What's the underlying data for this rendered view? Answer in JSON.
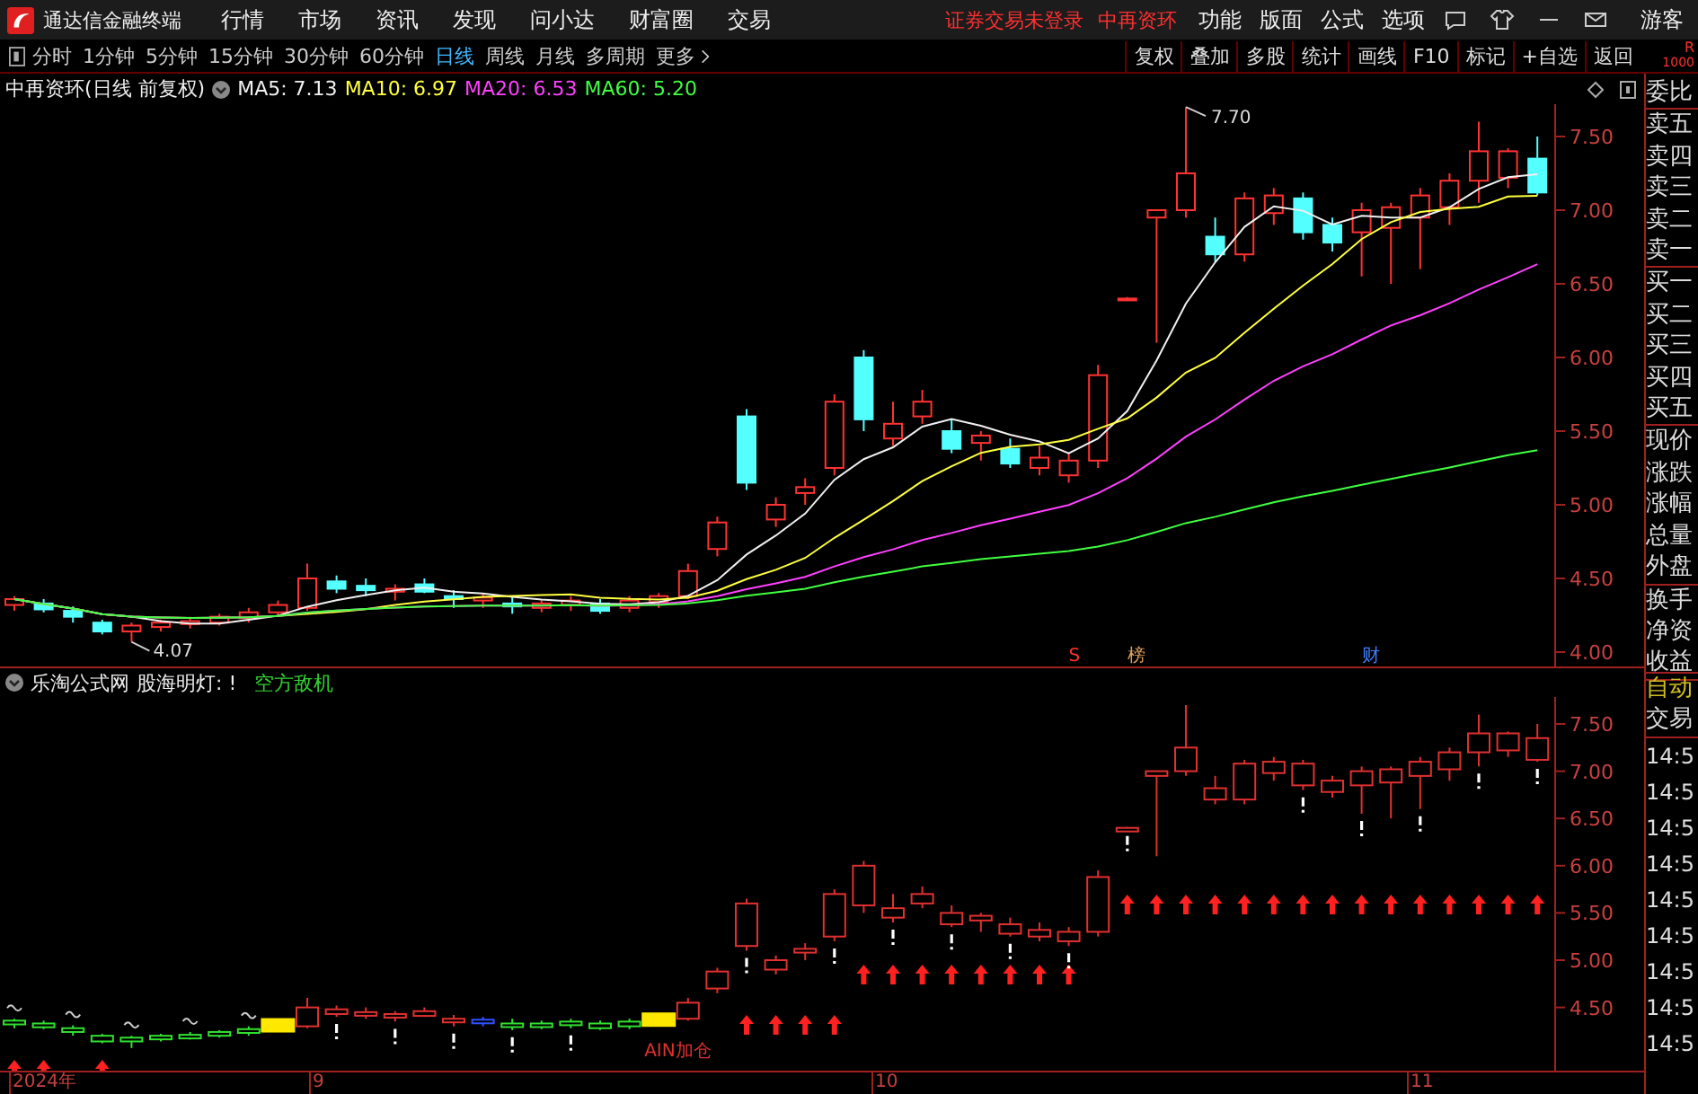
{
  "title_bar": {
    "app_title": "通达信金融终端",
    "menu": [
      "行情",
      "市场",
      "资讯",
      "发现",
      "问小达",
      "财富圈",
      "交易"
    ],
    "notice": "证券交易未登录",
    "stock": "中再资环",
    "right_menu": [
      "功能",
      "版面",
      "公式",
      "选项"
    ],
    "user": "游客"
  },
  "period_tabs": [
    {
      "label": "分时",
      "selected": false
    },
    {
      "label": "1分钟",
      "selected": false
    },
    {
      "label": "5分钟",
      "selected": false
    },
    {
      "label": "15分钟",
      "selected": false
    },
    {
      "label": "30分钟",
      "selected": false
    },
    {
      "label": "60分钟",
      "selected": false
    },
    {
      "label": "日线",
      "selected": true
    },
    {
      "label": "周线",
      "selected": false
    },
    {
      "label": "月线",
      "selected": false
    },
    {
      "label": "多周期",
      "selected": false
    },
    {
      "label": "更多",
      "selected": false
    }
  ],
  "tool_buttons": [
    "复权",
    "叠加",
    "多股",
    "统计",
    "画线",
    "F10",
    "标记",
    "+自选",
    "返回"
  ],
  "corner": {
    "label": "R",
    "value": "1000"
  },
  "legend": {
    "stock": "中再资环(日线 前复权)",
    "ma": [
      {
        "label": "MA5: 7.13",
        "color": "#f0f0f0"
      },
      {
        "label": "MA10: 6.97",
        "color": "#ffff40"
      },
      {
        "label": "MA20: 6.53",
        "color": "#ff40ff"
      },
      {
        "label": "MA60: 5.20",
        "color": "#40ff40"
      }
    ]
  },
  "main_chart": {
    "y_ticks": [
      "7.50",
      "7.00",
      "6.50",
      "6.00",
      "5.50",
      "5.00",
      "4.50",
      "4.00"
    ],
    "high_label": "7.70",
    "low_label": "4.07",
    "markers": [
      {
        "text": "S",
        "color": "#ff3030"
      },
      {
        "text": "榜",
        "color": "#e0a060"
      },
      {
        "text": "财",
        "color": "#4080ff"
      }
    ]
  },
  "quote_panel": {
    "groups": [
      [
        "委比"
      ],
      [
        "卖五",
        "卖四",
        "卖三",
        "卖二",
        "卖一"
      ],
      [
        "买一",
        "买二",
        "买三",
        "买四",
        "买五"
      ],
      [
        "现价",
        "涨跌",
        "涨幅",
        "总量",
        "外盘"
      ],
      [
        "换手",
        "净资",
        "收益"
      ]
    ]
  },
  "indicator": {
    "source": "乐淘公式网",
    "title": "股海明灯: !",
    "signal": "空方敌机",
    "y_ticks": [
      "7.50",
      "7.00",
      "6.50",
      "6.00",
      "5.50",
      "5.00",
      "4.50"
    ],
    "note": "AIN加仓"
  },
  "x_axis": [
    "2024年",
    "9",
    "10",
    "11"
  ],
  "trade_panel": {
    "mode": "自动",
    "label": "交易",
    "times": [
      "14:5",
      "14:5",
      "14:5",
      "14:5",
      "14:5",
      "14:5",
      "14:5",
      "14:5",
      "14:5"
    ]
  }
}
